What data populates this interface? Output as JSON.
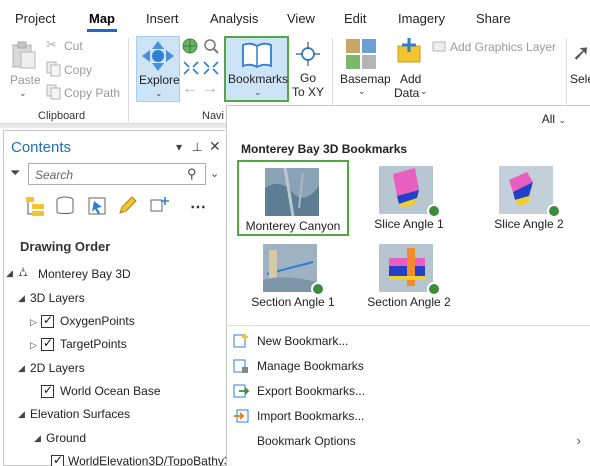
{
  "ribbon_tabs": [
    "Project",
    "Map",
    "Insert",
    "Analysis",
    "View",
    "Edit",
    "Imagery",
    "Share"
  ],
  "active_tab": "Map",
  "clipboard": {
    "paste": "Paste",
    "cut": "Cut",
    "copy": "Copy",
    "copy_path": "Copy Path",
    "group_label": "Clipboard"
  },
  "navigate": {
    "explore": "Explore",
    "bookmarks": "Bookmarks",
    "go_to_xy_line1": "Go",
    "go_to_xy_line2": "To XY",
    "group_label": "Navi"
  },
  "layer": {
    "basemap": "Basemap",
    "add_data_line1": "Add",
    "add_data_line2": "Data",
    "add_graphics_layer": "Add Graphics Layer",
    "select_partial": "Sele"
  },
  "contents": {
    "title": "Contents",
    "search_placeholder": "Search",
    "drawing_order": "Drawing Order",
    "tree": {
      "map": "Monterey Bay 3D",
      "layers_3d": "3D Layers",
      "oxygen_points": "OxygenPoints",
      "target_points": "TargetPoints",
      "layers_2d": "2D Layers",
      "world_ocean_base": "World Ocean Base",
      "elevation_surfaces": "Elevation Surfaces",
      "ground": "Ground",
      "world_elevation": "WorldElevation3D/TopoBathy3"
    }
  },
  "gallery": {
    "filter": "All",
    "header": "Monterey Bay 3D Bookmarks",
    "bookmarks": [
      "Monterey Canyon",
      "Slice Angle 1",
      "Slice Angle 2",
      "Section Angle 1",
      "Section Angle 2"
    ],
    "menu": {
      "new_bookmark": "New Bookmark...",
      "manage_bookmarks": "Manage Bookmarks",
      "export_bookmarks": "Export Bookmarks...",
      "import_bookmarks": "Import Bookmarks...",
      "bookmark_options": "Bookmark Options"
    }
  },
  "colors": {
    "accent": "#1b6ac9",
    "highlight_border": "#53a844",
    "selected_button_bg": "#cde4f7",
    "contents_title": "#1d6fb8"
  }
}
